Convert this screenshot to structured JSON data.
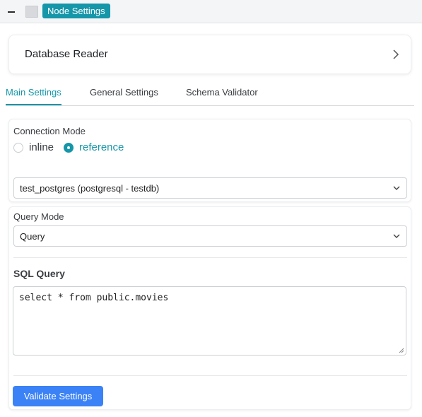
{
  "window": {
    "badge_label": "Node Settings"
  },
  "header": {
    "title": "Database Reader"
  },
  "tabs": [
    {
      "label": "Main Settings",
      "active": true
    },
    {
      "label": "General Settings",
      "active": false
    },
    {
      "label": "Schema Validator",
      "active": false
    }
  ],
  "connection": {
    "label": "Connection Mode",
    "options": [
      {
        "label": "inline",
        "checked": false
      },
      {
        "label": "reference",
        "checked": true
      }
    ],
    "selected_connection": "test_postgres (postgresql - testdb)"
  },
  "query": {
    "mode_label": "Query Mode",
    "mode_value": "Query",
    "sql_label": "SQL Query",
    "sql_value": "select * from public.movies"
  },
  "actions": {
    "validate_label": "Validate Settings"
  },
  "colors": {
    "accent": "#1596a9",
    "primary_button": "#3b82f6"
  },
  "icons": {
    "header_chevron": "chevron-right-icon",
    "select_chevron": "chevron-down-icon"
  }
}
